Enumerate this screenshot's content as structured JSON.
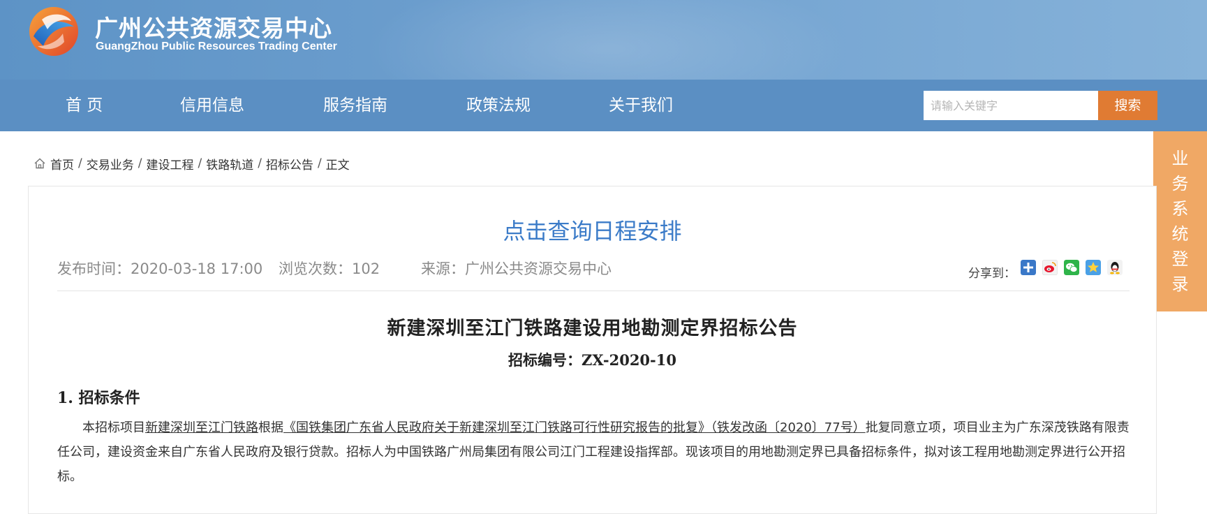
{
  "header": {
    "title_cn": "广州公共资源交易中心",
    "title_en": "GuangZhou Public Resources Trading Center"
  },
  "nav": {
    "items": [
      "首 页",
      "信用信息",
      "服务指南",
      "政策法规",
      "关于我们"
    ],
    "search_placeholder": "请输入关键字",
    "search_button": "搜索"
  },
  "side_tab": {
    "chars": [
      "业",
      "务",
      "系",
      "统",
      "登",
      "录"
    ]
  },
  "breadcrumb": {
    "items": [
      "首页",
      "交易业务",
      "建设工程",
      "铁路轨道",
      "招标公告",
      "正文"
    ],
    "separator": "/"
  },
  "article": {
    "schedule_link": "点击查询日程安排",
    "publish_time": "发布时间：2020-03-18 17:00",
    "views": "浏览次数：102",
    "source": "来源：广州公共资源交易中心",
    "share_label": "分享到：",
    "title": "新建深圳至江门铁路建设用地勘测定界招标公告",
    "number": "招标编号：ZX-2020-10",
    "section1_heading": "1. 招标条件",
    "para_pre": "本招标项目",
    "para_u1": "新建深圳至江门铁路",
    "para_mid1": "根据",
    "para_u2": "《国铁集团广东省人民政府关于新建深圳至江门铁路可行性研究报告的批复》（铁发改函〔2020〕77号）",
    "para_rest": "批复同意立项，项目业主为广东深茂铁路有限责任公司，建设资金来自广东省人民政府及银行贷款。招标人为中国铁路广州局集团有限公司江门工程建设指挥部。现该项目的用地勘测定界已具备招标条件，拟对该工程用地勘测定界进行公开招标。"
  },
  "colors": {
    "nav_bg": "#5b8fc3",
    "accent_orange": "#e07b33",
    "side_tab": "#f0a865",
    "link_blue": "#3b7bc8"
  },
  "share_icons": [
    "plus-share-icon",
    "weibo-icon",
    "wechat-icon",
    "qzone-icon",
    "qq-icon"
  ]
}
